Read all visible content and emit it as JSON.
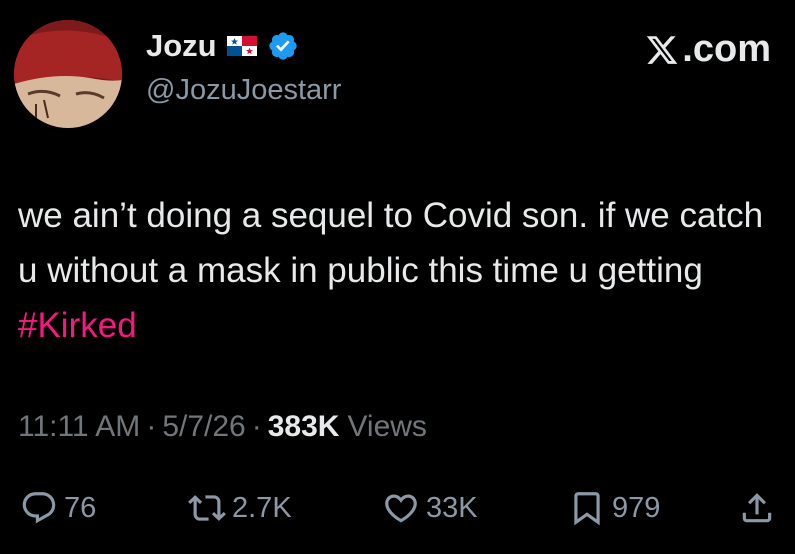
{
  "user": {
    "display_name": "Jozu",
    "handle": "@JozuJoestarr",
    "flag_icon": "panama-flag-icon",
    "verified_icon": "verified-badge-icon"
  },
  "brand": {
    "logo_icon": "x-logo-icon",
    "text": ".com"
  },
  "tweet": {
    "text": "we ain’t doing a sequel to Covid son. if we catch u without a mask in public this time u getting ",
    "hashtag": "#Kirked"
  },
  "meta": {
    "time": "11:11 AM",
    "separator": "·",
    "date": "5/7/26",
    "views_count": "383K",
    "views_label": "Views"
  },
  "actions": {
    "replies": "76",
    "reposts": "2.7K",
    "likes": "33K",
    "bookmarks": "979"
  },
  "colors": {
    "background": "#000000",
    "text_primary": "#e7e9ea",
    "text_secondary": "#71767b",
    "hashtag": "#f91880",
    "verified": "#1d9bf0"
  }
}
